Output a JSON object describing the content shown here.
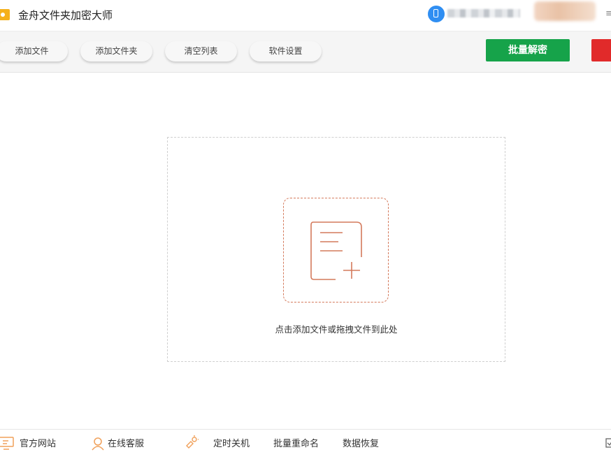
{
  "window": {
    "title": "金舟文件夹加密大师",
    "title_edge_char": "≡"
  },
  "toolbar": {
    "buttons": [
      {
        "label": "添加文件"
      },
      {
        "label": "添加文件夹"
      },
      {
        "label": "清空列表"
      },
      {
        "label": "软件设置"
      }
    ],
    "primary_action": "批量解密"
  },
  "dropzone": {
    "hint": "点击添加文件或拖拽文件到此处"
  },
  "footer": {
    "items": [
      {
        "label": "官方网站",
        "icon": "monitor-icon"
      },
      {
        "label": "在线客服",
        "icon": "person-icon"
      },
      {
        "label": "定时关机",
        "icon": "clock-icon"
      },
      {
        "label": "批量重命名",
        "icon": ""
      },
      {
        "label": "数据恢复",
        "icon": ""
      }
    ]
  },
  "colors": {
    "accent_green": "#16a34a",
    "accent_red": "#e12a2a",
    "drop_icon": "#d47a5c",
    "footer_icon": "#f0a05a"
  }
}
